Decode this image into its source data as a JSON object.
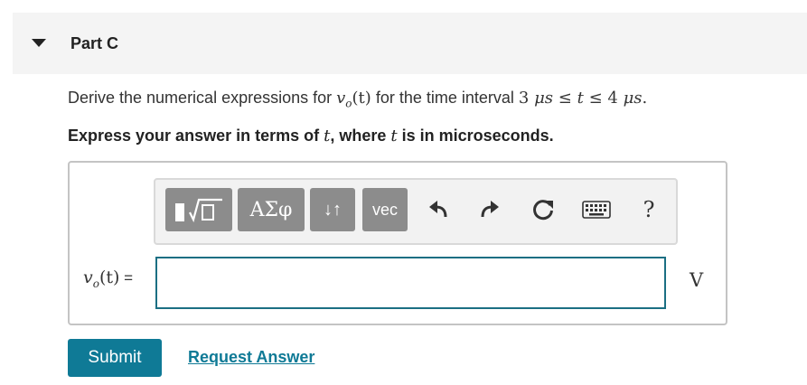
{
  "part": {
    "title": "Part C"
  },
  "question": {
    "prefix": "Derive the numerical expressions for ",
    "var_main": "v",
    "var_sub": "o",
    "var_arg": "(t)",
    "middle": " for the time interval ",
    "lower_num": "3",
    "unit_mu": "μ",
    "unit_s": "s",
    "leq": "≤",
    "t": "t",
    "upper_num": "4",
    "period": "."
  },
  "instruction": {
    "prefix": "Express your answer in terms of ",
    "var1": "t",
    "middle": ", where ",
    "var2": "t",
    "suffix": " is in microseconds."
  },
  "toolbar": {
    "greek_label": "ΑΣφ",
    "arrows_label": "↓↑",
    "vec_label": "vec",
    "help_label": "?"
  },
  "answer": {
    "lhs_var": "v",
    "lhs_sub": "o",
    "lhs_arg": "(t)",
    "lhs_equals": " =",
    "value": "",
    "unit": "V"
  },
  "actions": {
    "submit_label": "Submit",
    "request_label": "Request Answer"
  },
  "colors": {
    "accent": "#0f7a96",
    "input_border": "#1b6f83",
    "toolbar_button": "#8c8c8c"
  }
}
